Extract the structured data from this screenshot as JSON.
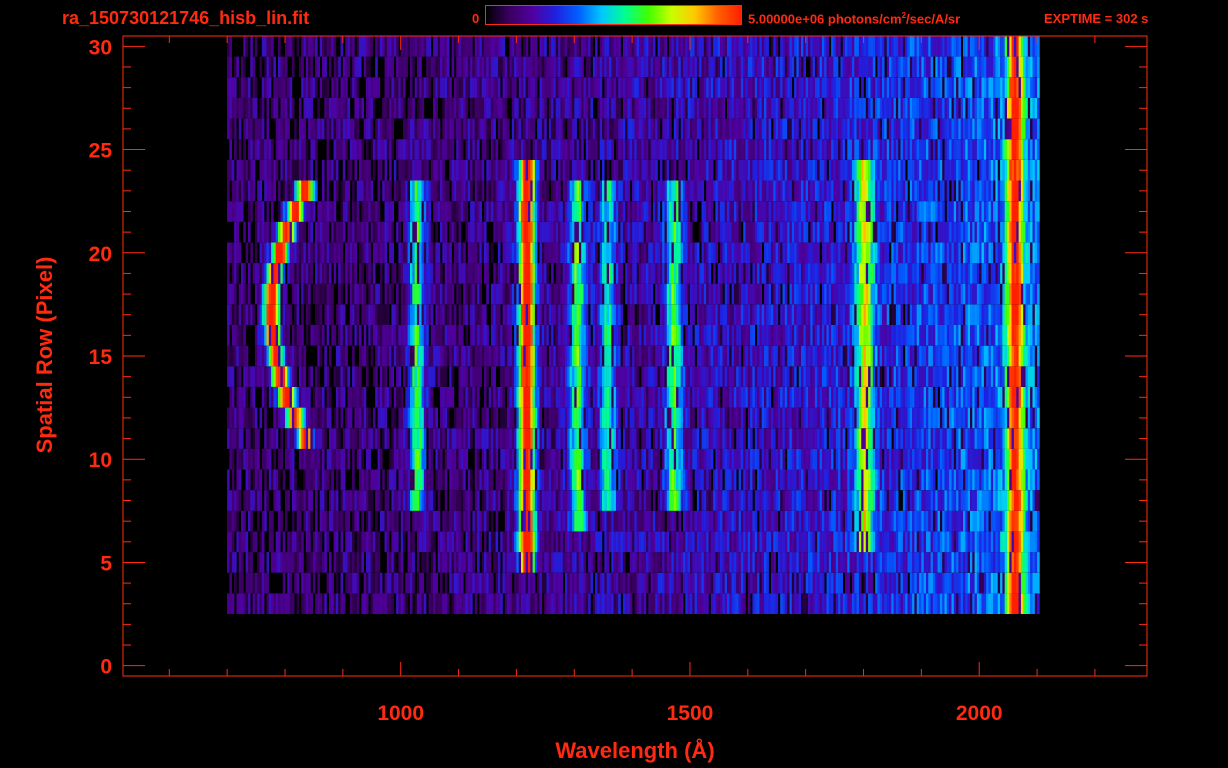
{
  "header": {
    "filename": "ra_150730121746_hisb_lin.fit",
    "colorbar_min": "0",
    "colorbar_max": "5.00000e+06 photons/cm",
    "colorbar_max_exp": "2",
    "colorbar_max_suffix": "/sec/A/sr",
    "exptime": "EXPTIME = 302 s"
  },
  "colors": {
    "axis": "#ff2a10",
    "background": "#000000",
    "colormap": [
      "#000000",
      "#3a0060",
      "#5000a0",
      "#2020e0",
      "#0060ff",
      "#00c8ff",
      "#00ff90",
      "#40ff00",
      "#c8ff00",
      "#ffc800",
      "#ff6000",
      "#ff2000"
    ]
  },
  "chart_data": {
    "type": "heatmap",
    "title": "",
    "xlabel": "Wavelength (Å)",
    "ylabel": "Spatial Row (Pixel)",
    "xlim": [
      520,
      2290
    ],
    "ylim": [
      -0.5,
      30.5
    ],
    "xticks": [
      1000,
      1500,
      2000
    ],
    "xtick_labels": [
      "1000",
      "1500",
      "2000"
    ],
    "yticks": [
      0,
      5,
      10,
      15,
      20,
      25,
      30
    ],
    "ytick_labels": [
      "0",
      "5",
      "10",
      "15",
      "20",
      "25",
      "30"
    ],
    "colorbar_range": [
      0,
      5000000
    ],
    "colorbar_units": "photons/cm^2/sec/A/sr",
    "scale": "linear",
    "data_extent": {
      "x": [
        700,
        2100
      ],
      "y": [
        3,
        30
      ]
    },
    "emission_features": [
      {
        "wavelength": 830,
        "rows": [
          11,
          23
        ],
        "peak_intensity": 0.95,
        "shape": "arc"
      },
      {
        "wavelength": 1026,
        "rows": [
          8,
          23
        ],
        "peak_intensity": 0.45
      },
      {
        "wavelength": 1216,
        "rows": [
          5,
          24
        ],
        "peak_intensity": 0.98
      },
      {
        "wavelength": 1304,
        "rows": [
          7,
          23
        ],
        "peak_intensity": 0.45
      },
      {
        "wavelength": 1356,
        "rows": [
          8,
          23
        ],
        "peak_intensity": 0.35
      },
      {
        "wavelength": 1470,
        "rows": [
          8,
          23
        ],
        "peak_intensity": 0.4
      },
      {
        "wavelength": 1800,
        "rows": [
          6,
          24
        ],
        "peak_intensity": 0.5
      },
      {
        "wavelength": 2060,
        "rows": [
          2,
          30
        ],
        "peak_intensity": 0.7
      }
    ]
  }
}
